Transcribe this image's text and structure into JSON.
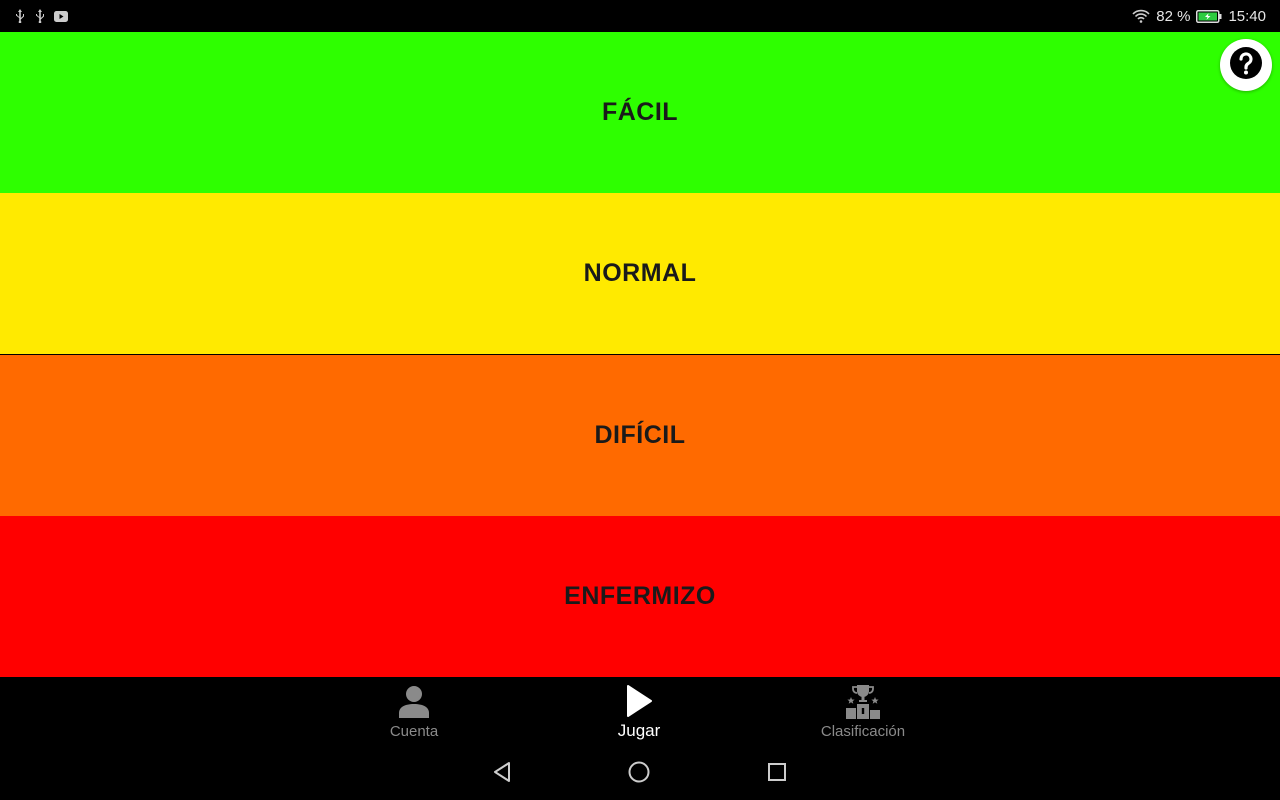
{
  "status_bar": {
    "battery_percent": "82 %",
    "time": "15:40",
    "left_icons": [
      "usb-icon",
      "usb-icon",
      "youtube-icon"
    ],
    "right_icons": [
      "wifi-icon",
      "battery-charging-icon"
    ]
  },
  "difficulties": [
    {
      "label": "FÁCIL",
      "color": "#2eff00"
    },
    {
      "label": "NORMAL",
      "color": "#ffea00"
    },
    {
      "label": "DIFÍCIL",
      "color": "#ff6a00"
    },
    {
      "label": "ENFERMIZO",
      "color": "#ff0000"
    }
  ],
  "help": {
    "icon": "help-icon"
  },
  "bottom_nav": {
    "items": [
      {
        "label": "Cuenta",
        "icon": "person-icon",
        "active": false
      },
      {
        "label": "Jugar",
        "icon": "play-icon",
        "active": true
      },
      {
        "label": "Clasificación",
        "icon": "trophy-podium-icon",
        "active": false
      }
    ]
  },
  "system_nav": [
    "back-icon",
    "home-icon",
    "recent-apps-icon"
  ]
}
